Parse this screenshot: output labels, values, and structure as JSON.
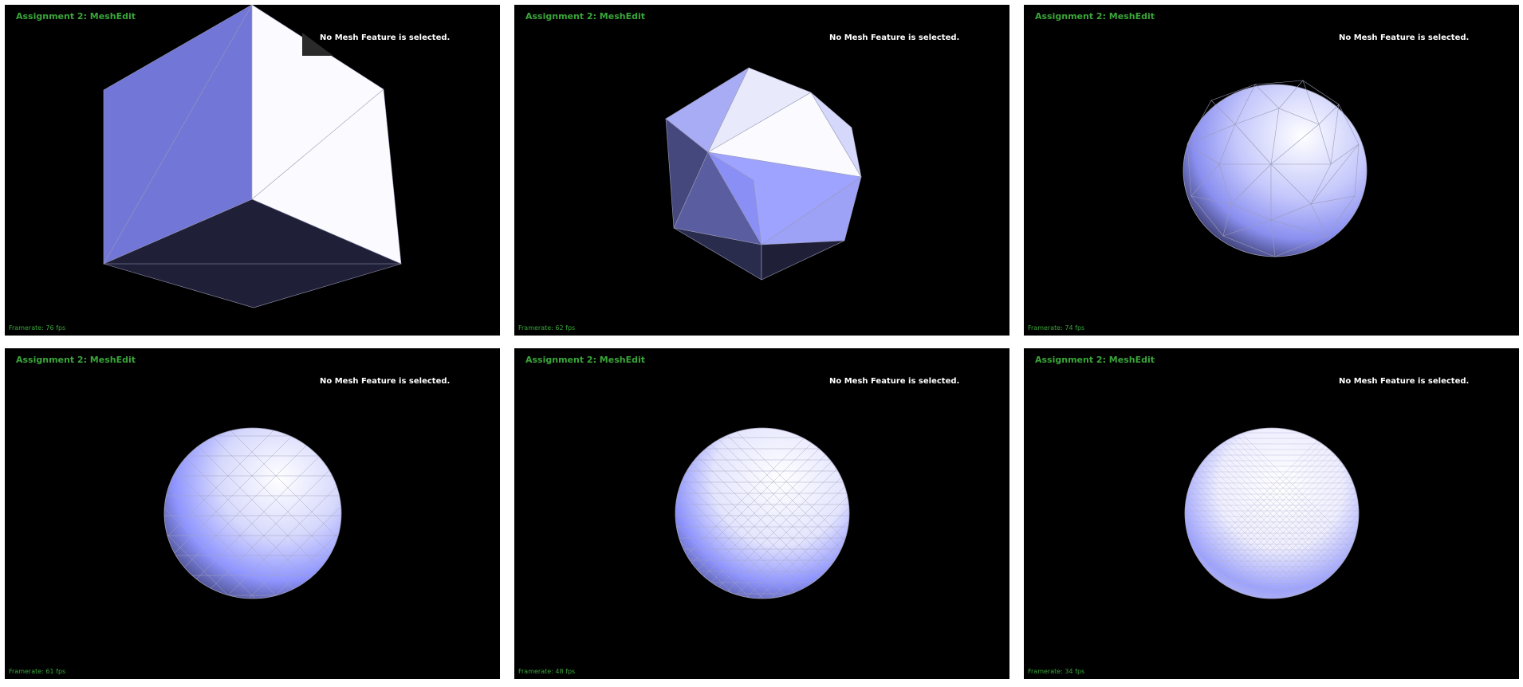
{
  "colors": {
    "background": "#000000",
    "title_green": "#3aa63a",
    "status_white": "#ffffff",
    "mesh_light": "#fbfbff",
    "mesh_mid": "#8f95ff",
    "mesh_dark": "#1f2038"
  },
  "panels": [
    {
      "title": "Assignment 2: MeshEdit",
      "status": "No Mesh Feature is selected.",
      "framerate": "Framerate: 76 fps",
      "mesh": "cube"
    },
    {
      "title": "Assignment 2: MeshEdit",
      "status": "No Mesh Feature is selected.",
      "framerate": "Framerate: 62 fps",
      "mesh": "subdivision-1"
    },
    {
      "title": "Assignment 2: MeshEdit",
      "status": "No Mesh Feature is selected.",
      "framerate": "Framerate: 74 fps",
      "mesh": "subdivision-2"
    },
    {
      "title": "Assignment 2: MeshEdit",
      "status": "No Mesh Feature is selected.",
      "framerate": "Framerate: 61 fps",
      "mesh": "subdivision-3"
    },
    {
      "title": "Assignment 2: MeshEdit",
      "status": "No Mesh Feature is selected.",
      "framerate": "Framerate: 48 fps",
      "mesh": "subdivision-4"
    },
    {
      "title": "Assignment 2: MeshEdit",
      "status": "No Mesh Feature is selected.",
      "framerate": "Framerate: 34 fps",
      "mesh": "subdivision-5"
    }
  ]
}
